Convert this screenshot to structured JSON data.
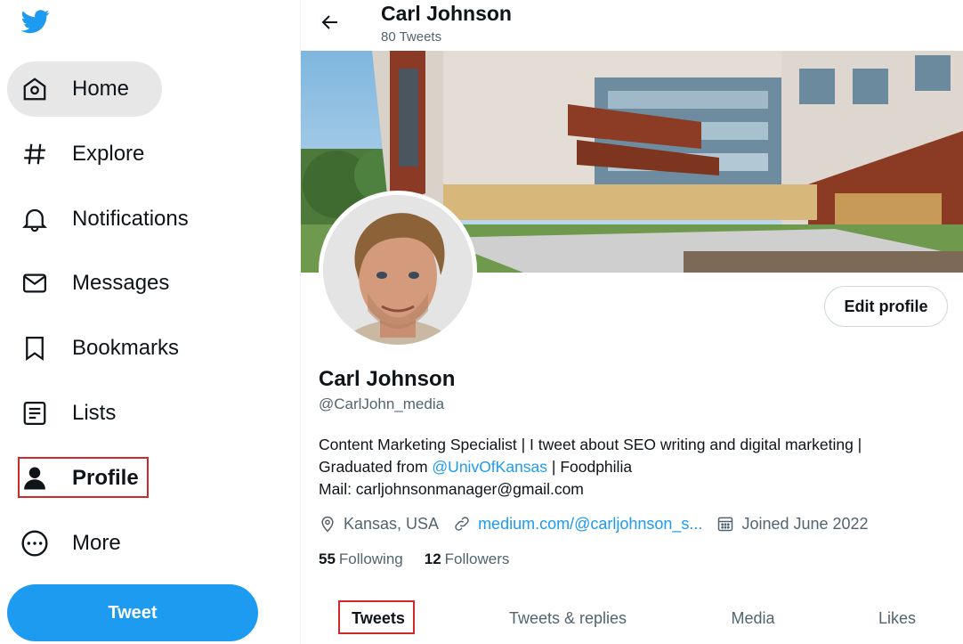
{
  "sidebar": {
    "logo": "twitter-bird-icon",
    "items": [
      {
        "label": "Home",
        "icon": "home-icon"
      },
      {
        "label": "Explore",
        "icon": "hashtag-icon"
      },
      {
        "label": "Notifications",
        "icon": "bell-icon"
      },
      {
        "label": "Messages",
        "icon": "envelope-icon"
      },
      {
        "label": "Bookmarks",
        "icon": "bookmark-icon"
      },
      {
        "label": "Lists",
        "icon": "list-icon"
      },
      {
        "label": "Profile",
        "icon": "person-icon"
      },
      {
        "label": "More",
        "icon": "more-circle-icon"
      }
    ],
    "tweet_button": "Tweet"
  },
  "header": {
    "title": "Carl Johnson",
    "subtitle": "80 Tweets"
  },
  "profile": {
    "edit_button": "Edit profile",
    "name": "Carl Johnson",
    "handle": "@CarlJohn_media",
    "bio_line1": "Content Marketing Specialist | I tweet about SEO writing and digital marketing |",
    "bio_line2_prefix": "Graduated from ",
    "bio_mention": "@UnivOfKansas",
    "bio_line2_suffix": " | Foodphilia",
    "bio_line3": "Mail: carljohnsonmanager@gmail.com",
    "location": "Kansas, USA",
    "website": "medium.com/@carljohnson_s...",
    "joined": "Joined June 2022",
    "following_count": "55",
    "following_label": "Following",
    "followers_count": "12",
    "followers_label": "Followers"
  },
  "tabs": [
    {
      "label": "Tweets"
    },
    {
      "label": "Tweets & replies"
    },
    {
      "label": "Media"
    },
    {
      "label": "Likes"
    }
  ],
  "colors": {
    "accent": "#1d9bf0",
    "highlight_box": "#d0282b"
  }
}
